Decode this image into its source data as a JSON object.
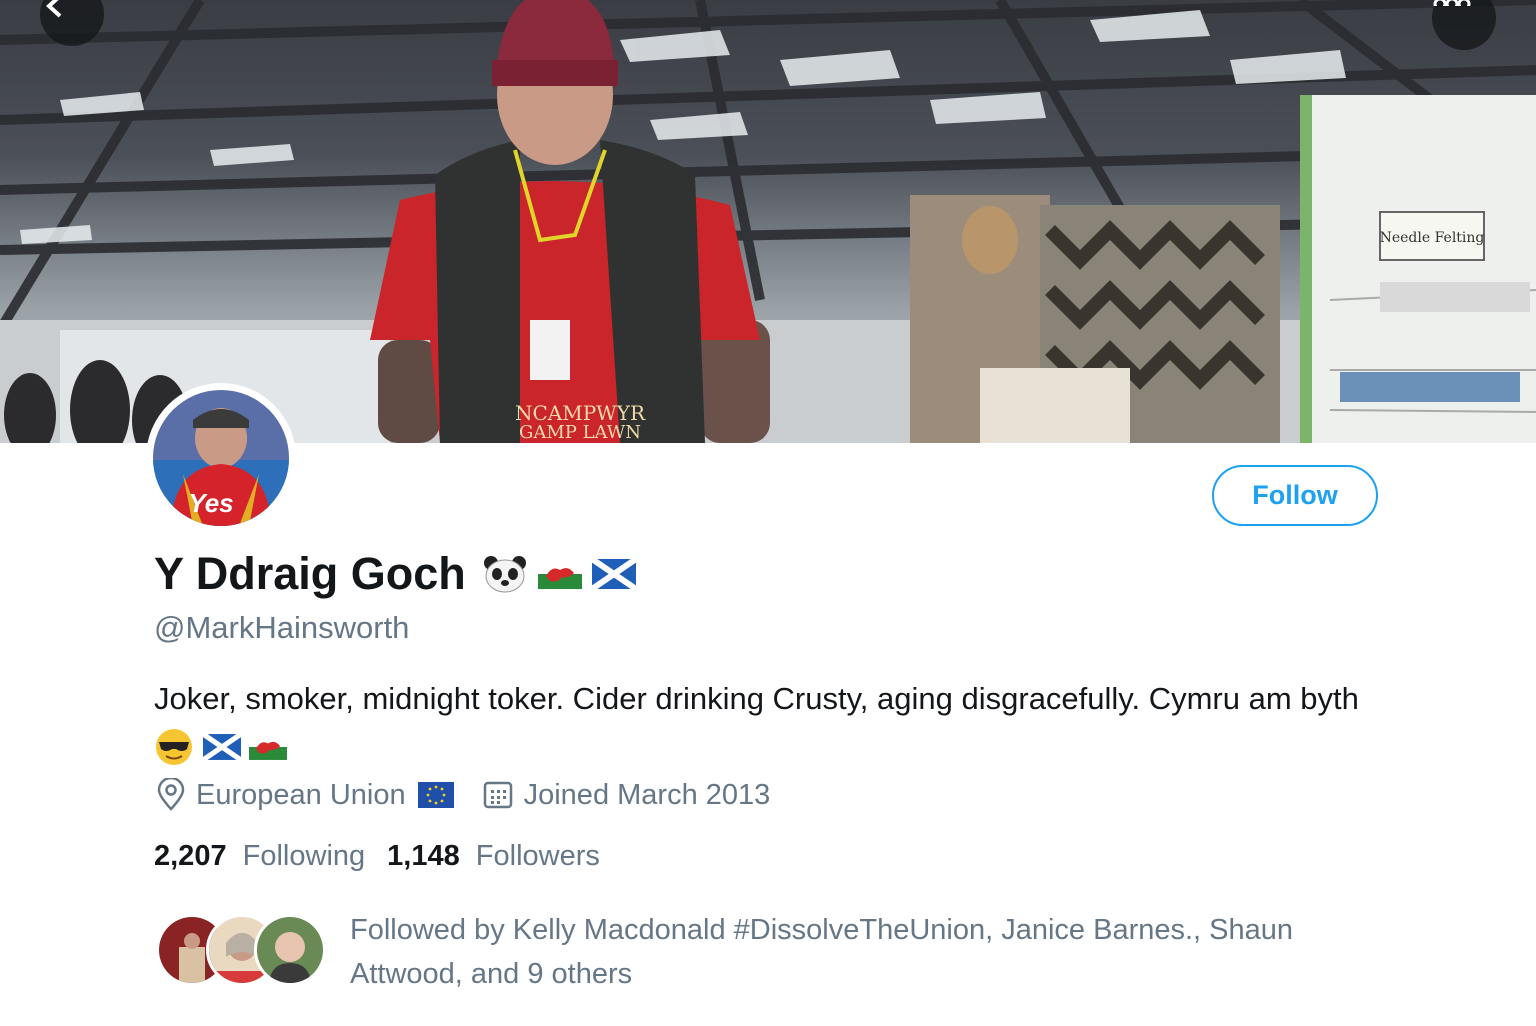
{
  "header": {
    "back_icon": "chevron-left-icon",
    "more_icon": "ellipsis-icon"
  },
  "banner": {
    "sign_text": "Needle Felting",
    "shirt_text_1": "NCAMPWYR",
    "shirt_text_2": "GAMP LAWN"
  },
  "profile": {
    "avatar_text": "Yes",
    "follow_label": "Follow",
    "display_name": "Y Ddraig Goch",
    "name_emojis": [
      "panda-face-icon",
      "wales-flag-icon",
      "scotland-flag-icon"
    ],
    "handle": "@MarkHainsworth",
    "bio": "Joker, smoker, midnight toker. Cider drinking Crusty, aging disgracefully. Cymru am byth",
    "bio_emojis": [
      "sunglasses-face-icon",
      "scotland-flag-icon",
      "wales-flag-icon"
    ],
    "location": "European Union",
    "joined": "Joined March 2013",
    "following_count": "2,207",
    "following_label": "Following",
    "followers_count": "1,148",
    "followers_label": "Followers",
    "followed_by": "Followed by Kelly Macdonald #DissolveTheUnion, Janice Barnes., Shaun Attwood, and 9 others"
  },
  "colors": {
    "accent": "#1da1f2",
    "text_primary": "#14171a",
    "text_secondary": "#657786"
  }
}
